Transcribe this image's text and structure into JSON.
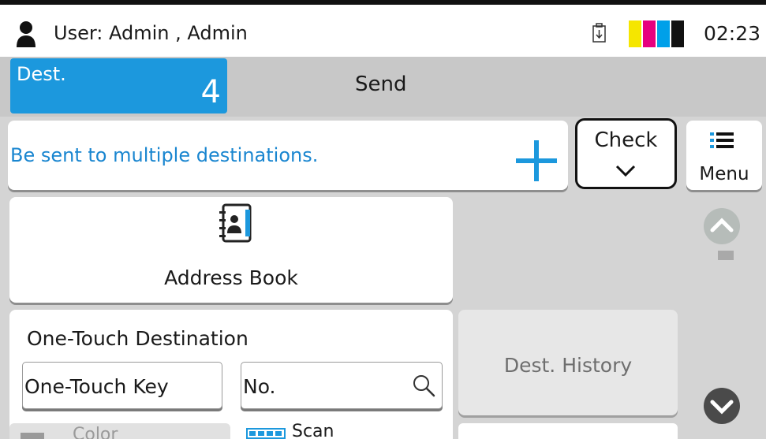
{
  "status": {
    "user_label": "User: Admin , Admin",
    "time": "02:23",
    "toner_colors": [
      "#f5e600",
      "#e6007e",
      "#00a0e9",
      "#111111"
    ]
  },
  "tabs": {
    "dest_label": "Dest.",
    "dest_count": "4",
    "send_label": "Send"
  },
  "destination_bar": {
    "message": "Be sent to multiple destinations.",
    "check_label": "Check",
    "menu_label": "Menu"
  },
  "address_book": {
    "label": "Address Book"
  },
  "one_touch": {
    "title": "One-Touch Destination",
    "key_label": "One-Touch Key",
    "number_label": "No."
  },
  "history": {
    "label": "Dest. History"
  },
  "bottom_row": {
    "left_label": "Color",
    "mid_label": "Scan"
  },
  "colors": {
    "accent_blue": "#1c98dd",
    "message_blue": "#1a86d0"
  }
}
